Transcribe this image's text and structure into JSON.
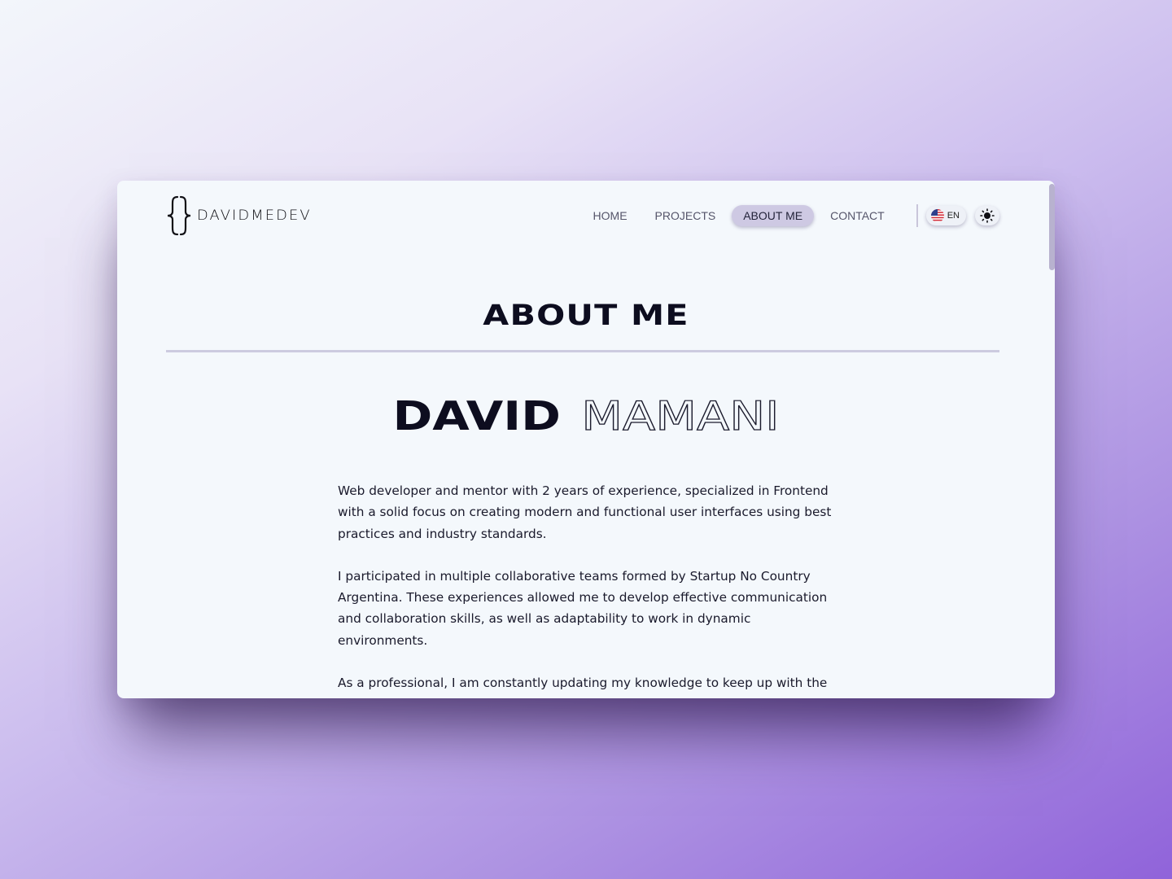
{
  "window": {
    "logo": {
      "text": "DAVIDMEDEV"
    },
    "nav": {
      "items": [
        {
          "label": "HOME",
          "active": false
        },
        {
          "label": "PROJECTS",
          "active": false
        },
        {
          "label": "ABOUT ME",
          "active": true
        },
        {
          "label": "CONTACT",
          "active": false
        }
      ],
      "language": "EN",
      "language_icon": "us-flag-icon",
      "theme_icon": "sun-icon"
    },
    "section_title": "ABOUT ME",
    "name": {
      "first": "DAVID",
      "last": "MAMANI"
    },
    "bio": [
      "Web developer and mentor with 2 years of experience, specialized in Frontend with a solid focus on creating modern and functional user interfaces using best practices and industry standards.",
      "I participated in multiple collaborative teams formed by Startup No Country Argentina. These experiences allowed me to develop effective communication and collaboration skills, as well as adaptability to work in dynamic environments.",
      "As a professional, I am constantly updating my knowledge to keep up with the"
    ]
  },
  "colors": {
    "accent": "#cec9e3",
    "text": "#0d0d1f",
    "window_bg": "#f4f8fc",
    "rule": "#cccbe0"
  }
}
